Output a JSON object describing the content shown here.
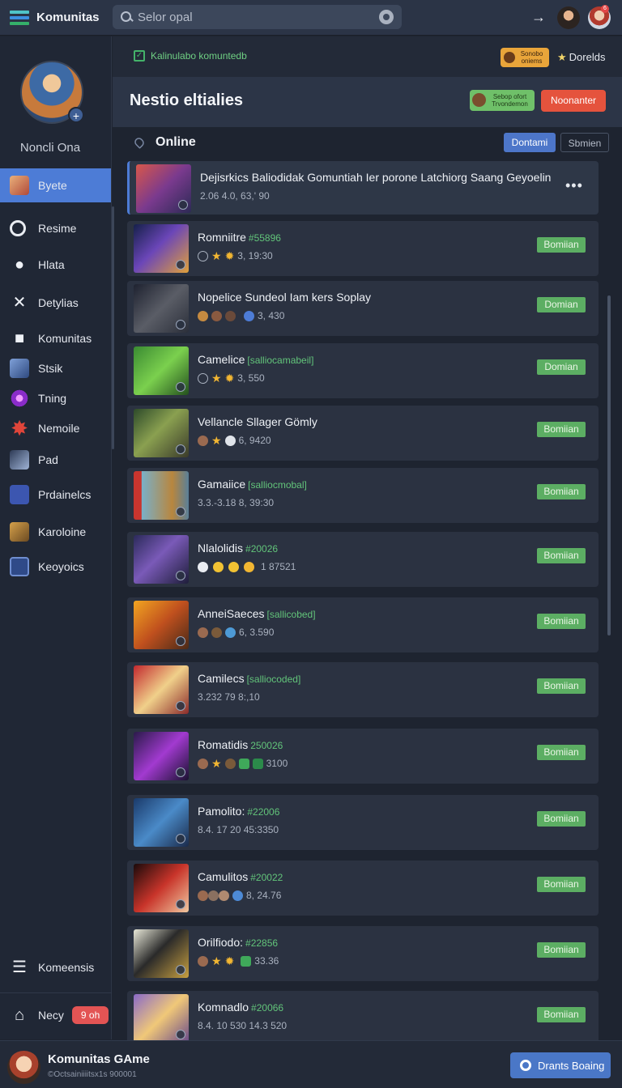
{
  "app": {
    "title": "Komunitas",
    "search_placeholder": "Selor opal",
    "notification_count": "6"
  },
  "sidebar": {
    "profile_name": "Noncli Ona",
    "items": [
      {
        "label": "Byete",
        "icon": "avatar-icon",
        "active": true
      },
      {
        "label": "Resime",
        "icon": "circle-target-icon"
      },
      {
        "label": "Hlata",
        "icon": "user-icon"
      },
      {
        "label": "Detylias",
        "icon": "crossed-swords-icon"
      },
      {
        "label": "Komunitas",
        "icon": "community-icon"
      },
      {
        "label": "Stsik",
        "icon": "knight-icon"
      },
      {
        "label": "Tning",
        "icon": "purple-burst-icon"
      },
      {
        "label": "Nemoile",
        "icon": "red-star-icon"
      },
      {
        "label": "Pad",
        "icon": "sword-icon"
      },
      {
        "label": "Prdainelcs",
        "icon": "book-icon"
      },
      {
        "label": "Karoloine",
        "icon": "treasure-icon"
      },
      {
        "label": "Keoyoics",
        "icon": "screen-icon"
      }
    ],
    "bottom_items": [
      {
        "label": "Komeensis",
        "icon": "list-icon"
      },
      {
        "label": "Necy",
        "icon": "home-icon",
        "badge": "9 oh"
      }
    ]
  },
  "main": {
    "status_text": "Kalinulabo komuntedb",
    "status_badge": "Sonobo oniems",
    "status_star_label": "Dorelds",
    "title": "Nestio eltialies",
    "promo_text": "Sebop ofort Trvondemon",
    "action_button": "Noonanter",
    "section_title": "Online",
    "tabs": [
      "Dontami",
      "Sbmien"
    ]
  },
  "rows": [
    {
      "title": "Dejisrkics Baliodidak Gomuntiah Ier porone Latchiorg Saang Geyoelin",
      "tag": "",
      "meta": "2.06 4.0, 63,' 90",
      "featured": true
    },
    {
      "title": "Romniitre",
      "tag": "#55896",
      "meta": "3, 19:30",
      "button": "Bomiian"
    },
    {
      "title": "Nopelice Sundeol Iam kers Soplay",
      "tag": "",
      "meta": "3, 430",
      "button": "Domian"
    },
    {
      "title": "Camelice",
      "tag": "[salliocamabeil]",
      "meta": "3, 550",
      "button": "Domian"
    },
    {
      "title": "Vellancle Sllager Gömly",
      "tag": "",
      "meta": "6, 9420",
      "button": "Bomiian"
    },
    {
      "title": "Gamaiice",
      "tag": "[salliocmobal]",
      "meta": "3.3.-3.18  8, 39:30",
      "button": "Bomiian"
    },
    {
      "title": "Nlalolidis",
      "tag": "#20026",
      "meta": "1 87521",
      "button": "Bomiian"
    },
    {
      "title": "AnneiSaeces",
      "tag": "[sallicobed]",
      "meta": "6, 3.590",
      "button": "Bomiian"
    },
    {
      "title": "Camilecs",
      "tag": "[salliocoded]",
      "meta": "3.232 79  8:,10",
      "button": "Bomiian"
    },
    {
      "title": "Romatidis",
      "tag": "250026",
      "meta": "3100",
      "button": "Bomiian"
    },
    {
      "title": "Pamolito:",
      "tag": "#22006",
      "meta": "8.4. 17 20  45:3350",
      "button": "Bomiian"
    },
    {
      "title": "Camulitos",
      "tag": "#20022",
      "meta": "8, 24.76",
      "button": "Bomiian"
    },
    {
      "title": "Orilfiodo:",
      "tag": "#22856",
      "meta": "33.36",
      "button": "Bomiian"
    },
    {
      "title": "Komnadlo",
      "tag": "#20066",
      "meta": "8.4. 10 530  14.3 520",
      "button": "Bomiian"
    }
  ],
  "bottom": {
    "title": "Komunitas GAme",
    "subtitle": "©Octsainiiiitsx1s 900001",
    "button": "Drants Boaing"
  },
  "colors": {
    "accent_blue": "#4d7cd6",
    "green_button": "#5cae63",
    "red_button": "#e5533d",
    "tag_green": "#62c47a"
  }
}
